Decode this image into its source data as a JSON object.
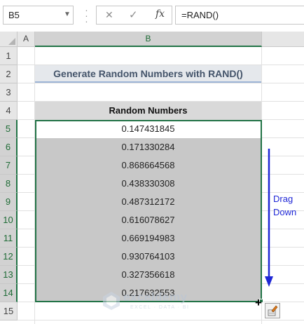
{
  "formula_bar": {
    "name_box": "B5",
    "fx_label": "fx",
    "formula": "=RAND()"
  },
  "columns": [
    "A",
    "B"
  ],
  "rows": [
    "1",
    "2",
    "3",
    "4",
    "5",
    "6",
    "7",
    "8",
    "9",
    "10",
    "11",
    "12",
    "13",
    "14",
    "15"
  ],
  "sheet": {
    "title": "Generate Random Numbers with RAND()",
    "table_header": "Random Numbers",
    "values": [
      "0.147431845",
      "0.171330284",
      "0.868664568",
      "0.438330308",
      "0.487312172",
      "0.616078627",
      "0.669194983",
      "0.930764103",
      "0.327356618",
      "0.217632553"
    ]
  },
  "annotation": {
    "label_line1": "Drag",
    "label_line2": "Down",
    "color": "#1f27d6"
  },
  "watermark": {
    "name": "exceldemy",
    "tagline": "EXCEL · DATA · BI"
  },
  "colors": {
    "accent": "#217346",
    "selection_fill": "#c8c8c8"
  }
}
